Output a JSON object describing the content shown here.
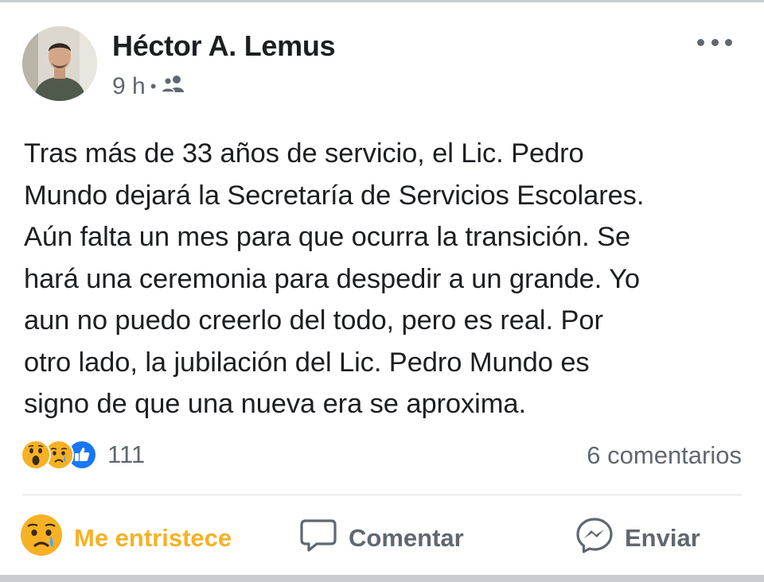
{
  "post": {
    "author": "Héctor A. Lemus",
    "time": "9 h",
    "separator": "•",
    "audience_icon": "friends-icon",
    "lines": [
      "Tras más de 33 años de servicio, el Lic. Pedro",
      "Mundo dejará la Secretaría de Servicios Escolares.",
      "Aún falta un mes para que ocurra la transición. Se",
      "hará una ceremonia para despedir a un grande. Yo",
      "aun no puedo creerlo del todo, pero es real. Por",
      "otro lado, la jubilación del Lic. Pedro Mundo es",
      "signo de que una nueva era se aproxima."
    ]
  },
  "reactions": {
    "icons": [
      "wow-icon",
      "sad-icon",
      "like-icon"
    ],
    "count": "111",
    "comments": "6 comentarios"
  },
  "actions": {
    "reaction_label": "Me entristece",
    "comment_label": "Comentar",
    "send_label": "Enviar"
  },
  "colors": {
    "sad_reaction": "#f7b125",
    "like_blue": "#1877f2",
    "secondary_text": "#606770"
  }
}
